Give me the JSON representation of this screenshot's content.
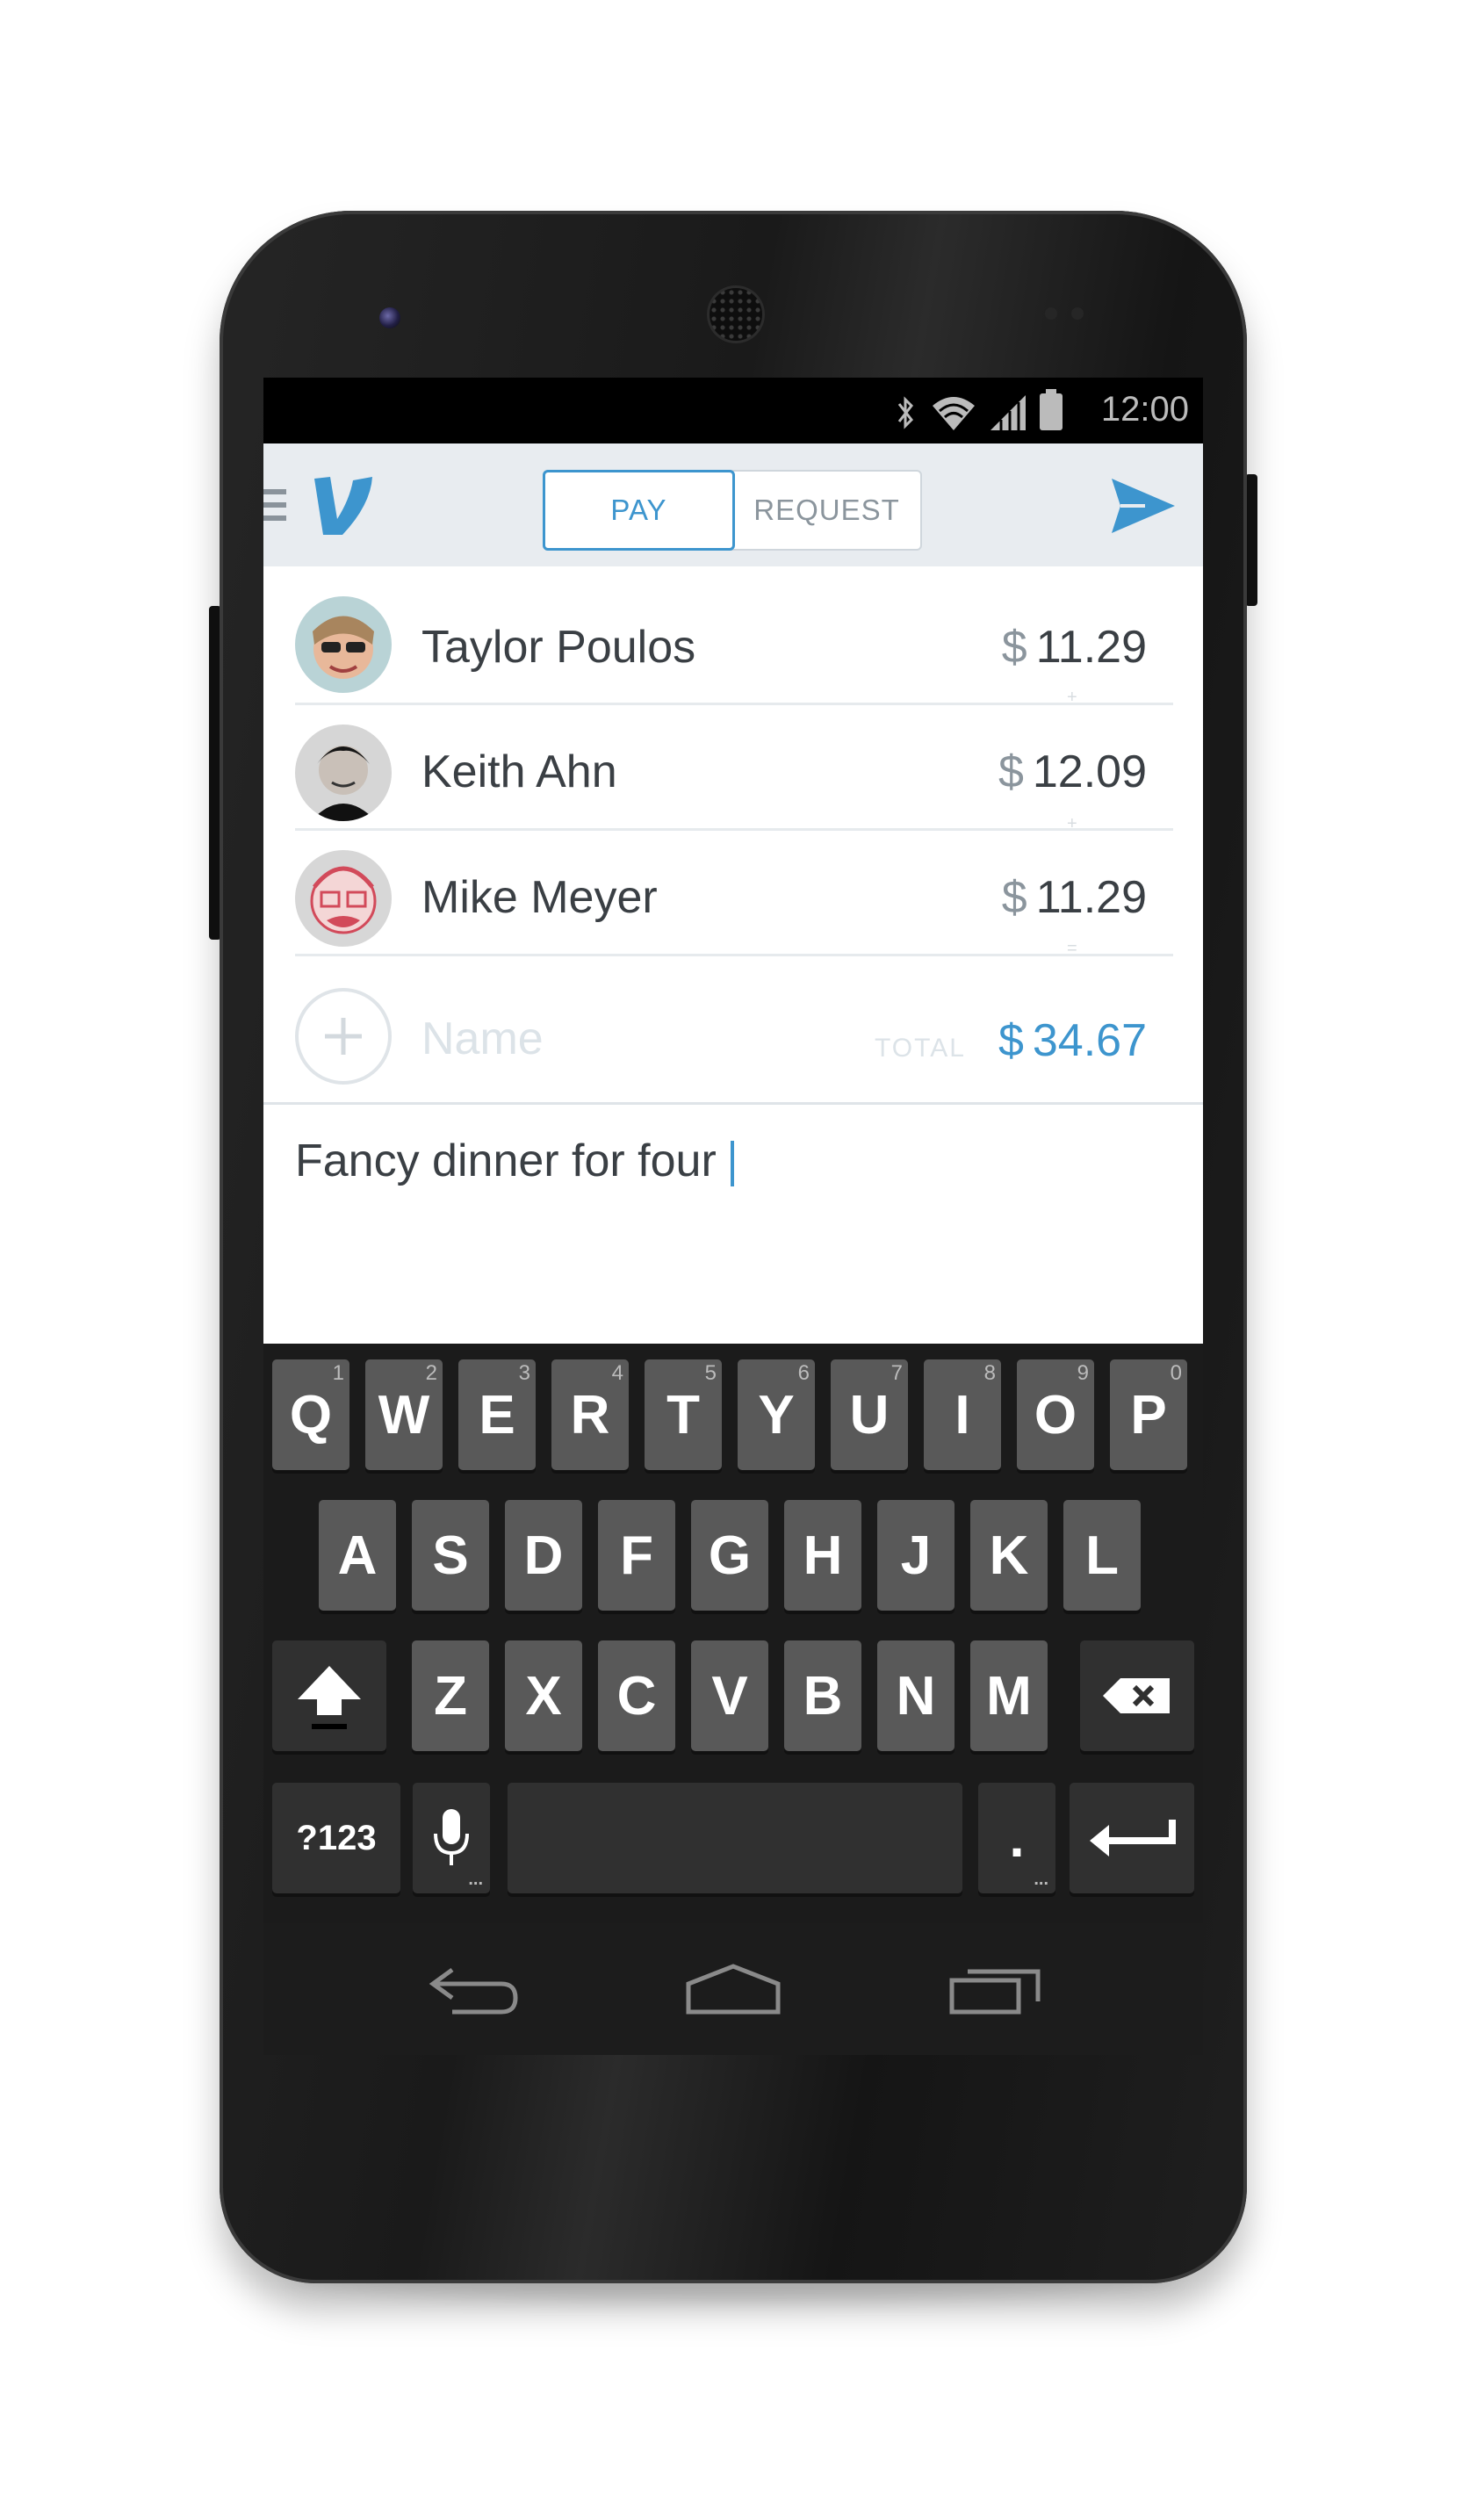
{
  "status_bar": {
    "time": "12:00",
    "icons": [
      "bluetooth-icon",
      "wifi-icon",
      "signal-icon",
      "battery-icon"
    ]
  },
  "app_bar": {
    "menu_icon": "menu-icon",
    "logo_icon": "venmo-v-logo",
    "tabs": [
      {
        "label": "PAY",
        "active": true
      },
      {
        "label": "REQUEST",
        "active": false
      }
    ],
    "send_icon": "send-icon"
  },
  "recipients": [
    {
      "name": "Taylor Poulos",
      "currency": "$",
      "amount": "11.29"
    },
    {
      "name": "Keith Ahn",
      "currency": "$",
      "amount": "12.09"
    },
    {
      "name": "Mike Meyer",
      "currency": "$",
      "amount": "11.29"
    }
  ],
  "operators": [
    "+",
    "+",
    "="
  ],
  "add_row": {
    "placeholder": "Name",
    "total_label": "TOTAL",
    "total_currency": "$",
    "total_amount": "34.67"
  },
  "note": {
    "text": "Fancy dinner for four"
  },
  "keyboard": {
    "row1": [
      {
        "k": "Q",
        "h": "1"
      },
      {
        "k": "W",
        "h": "2"
      },
      {
        "k": "E",
        "h": "3"
      },
      {
        "k": "R",
        "h": "4"
      },
      {
        "k": "T",
        "h": "5"
      },
      {
        "k": "Y",
        "h": "6"
      },
      {
        "k": "U",
        "h": "7"
      },
      {
        "k": "I",
        "h": "8"
      },
      {
        "k": "O",
        "h": "9"
      },
      {
        "k": "P",
        "h": "0"
      }
    ],
    "row2": [
      "A",
      "S",
      "D",
      "F",
      "G",
      "H",
      "J",
      "K",
      "L"
    ],
    "row3": [
      "Z",
      "X",
      "C",
      "V",
      "B",
      "N",
      "M"
    ],
    "symbols_label": "?123",
    "period_label": ".",
    "more_hint": "..."
  },
  "colors": {
    "accent": "#3d95ce",
    "app_bar_bg": "#e8ecf0",
    "text_dark": "#3a3f44",
    "key_bg": "#595959"
  }
}
